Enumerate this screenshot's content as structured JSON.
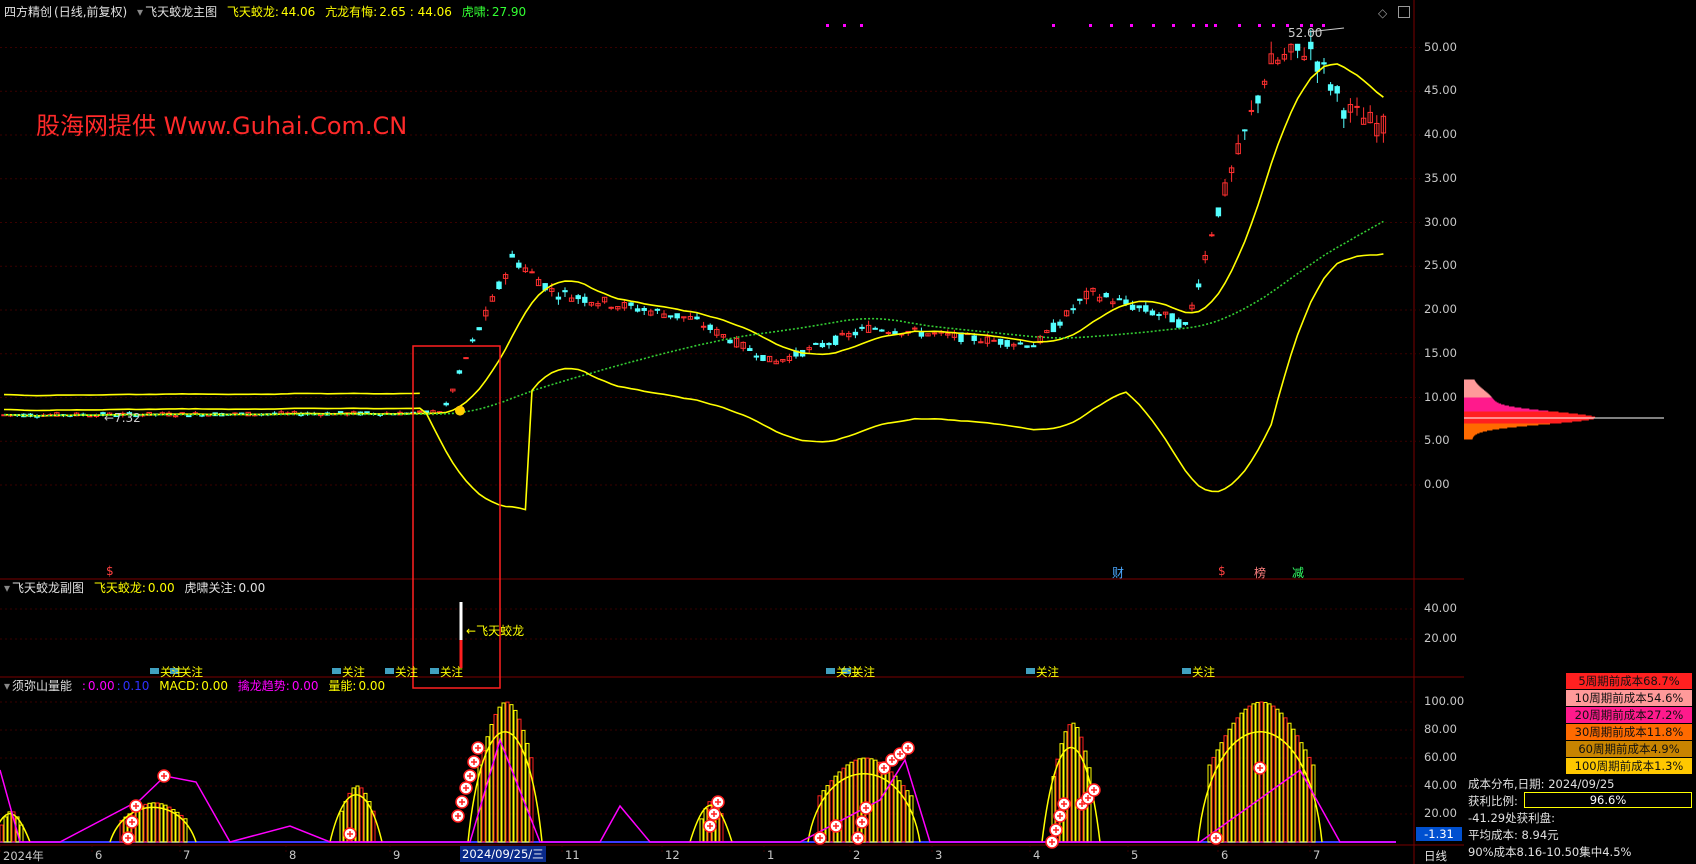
{
  "main_header": {
    "app": "四方精创",
    "period": "(日线,前复权)",
    "indicator": "飞天蛟龙主图",
    "v1_label": "飞天蛟龙:",
    "v1": "44.06",
    "v2_label": "亢龙有悔:",
    "v2": "2.65 : 44.06",
    "v3_label": "虎啸:",
    "v3": "27.90"
  },
  "watermark": "股海网提供 Www.Guhai.Com.CN",
  "price_axis": [
    "50.00",
    "45.00",
    "40.00",
    "35.00",
    "30.00",
    "25.00",
    "20.00",
    "15.00",
    "10.00",
    "5.00",
    "0.00"
  ],
  "price_labels": {
    "high": "52.00",
    "low": "7.32"
  },
  "event_tags": [
    "财",
    "$",
    "榜",
    "减"
  ],
  "sub_header": {
    "name": "飞天蛟龙副图",
    "v1_label": "飞天蛟龙:",
    "v1": "0.00",
    "v2_label": "虎啸关注:",
    "v2": "0.00"
  },
  "sub_axis": [
    "40.00",
    "20.00"
  ],
  "sub_signal_label": "飞天蛟龙",
  "focus_tag": "关注",
  "vol_header": {
    "name": "须弥山量能",
    "v1": "0.00",
    "v2": "0.10",
    "macd_label": "MACD:",
    "macd": "0.00",
    "trend_label": "擒龙趋势:",
    "trend": "0.00",
    "energy_label": "量能:",
    "energy": "0.00"
  },
  "vol_axis": [
    "100.00",
    "80.00",
    "60.00",
    "40.00",
    "20.00"
  ],
  "vol_current": "-1.31",
  "date_axis": [
    "2024年",
    "6",
    "7",
    "8",
    "9",
    "11",
    "12",
    "1",
    "2",
    "3",
    "4",
    "5",
    "6",
    "7"
  ],
  "date_highlight": "2024/09/25/三",
  "period_tab": "日线",
  "cost_table": [
    {
      "label": "5周期前成本68.7%",
      "color": "#ff2020"
    },
    {
      "label": "10周期前成本54.6%",
      "color": "#ff9a9a"
    },
    {
      "label": "20周期前成本27.2%",
      "color": "#ff1a8c"
    },
    {
      "label": "30周期前成本11.8%",
      "color": "#ff6a00"
    },
    {
      "label": "60周期前成本4.9%",
      "color": "#c88400"
    },
    {
      "label": "100周期前成本1.3%",
      "color": "#ffc800"
    }
  ],
  "chip_info": {
    "title": "成本分布,日期:",
    "date": "2024/09/25",
    "profit_label": "获利比例:",
    "profit_value": "96.6%",
    "profit_fraction": 0.966,
    "curve_label": "-41.29处获利盘:",
    "avg": "平均成本:  8.94元",
    "c90": "90%成本8.16-10.50集中4.5%"
  },
  "colors": {
    "background": "#000000",
    "up": "#ff3030",
    "down": "#54ffff",
    "ma_yellow": "#ffff00",
    "ma_green": "#33cc33",
    "purple": "#ff00ff",
    "box_red": "#ff2020"
  }
}
